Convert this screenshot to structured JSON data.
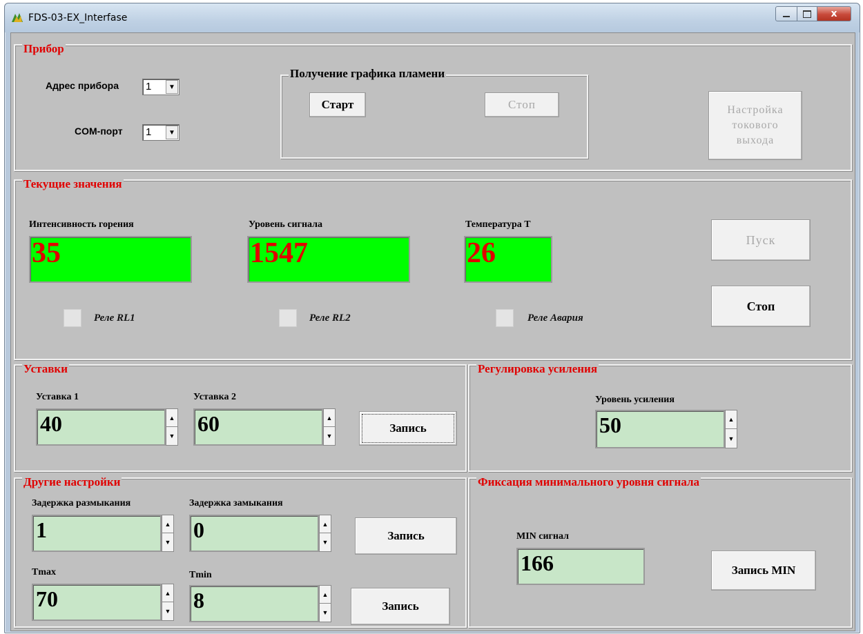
{
  "window": {
    "title": "FDS-03-EX_Interfase",
    "close_glyph": "x"
  },
  "device": {
    "group_title": "Прибор",
    "address_label": "Адрес прибора",
    "address_value": "1",
    "com_label": "COM-порт",
    "com_value": "1",
    "flame_graph": {
      "title": "Получение графика пламени",
      "start_label": "Старт",
      "stop_label": "Стоп"
    },
    "current_output_button": "Настройка токового выхода"
  },
  "current_values": {
    "group_title": "Текущие значения",
    "intensity_label": "Интенсивность горения",
    "intensity_value": "35",
    "signal_label": "Уровень сигнала",
    "signal_value": "1547",
    "temp_label": "Температура Т",
    "temp_value": "26",
    "start_button": "Пуск",
    "stop_button": "Стоп",
    "relays": [
      {
        "label": "Реле RL1"
      },
      {
        "label": "Реле RL2"
      },
      {
        "label": "Реле Авария"
      }
    ]
  },
  "setpoints": {
    "group_title": "Уставки",
    "setpoint1_label": "Уставка 1",
    "setpoint1_value": "40",
    "setpoint2_label": "Уставка 2",
    "setpoint2_value": "60",
    "write_button": "Запись"
  },
  "gain": {
    "group_title": "Регулировка усиления",
    "level_label": "Уровень усиления",
    "level_value": "50"
  },
  "other": {
    "group_title": "Другие настройки",
    "open_delay_label": "Задержка размыкания",
    "open_delay_value": "1",
    "close_delay_label": "Задержка замыкания",
    "close_delay_value": "0",
    "write_button_1": "Запись",
    "tmax_label": "Tmax",
    "tmax_value": "70",
    "tmin_label": "Tmin",
    "tmin_value": "8",
    "write_button_2": "Запись"
  },
  "min_signal": {
    "group_title": "Фиксация минимального уровня сигнала",
    "label": "MIN сигнал",
    "value": "166",
    "write_button": "Запись MIN"
  },
  "colors": {
    "accent_title": "#e00000",
    "live_field_bg": "#00ff00",
    "spin_field_bg": "#c8e6c8",
    "panel_bg": "#c0c0c0"
  }
}
